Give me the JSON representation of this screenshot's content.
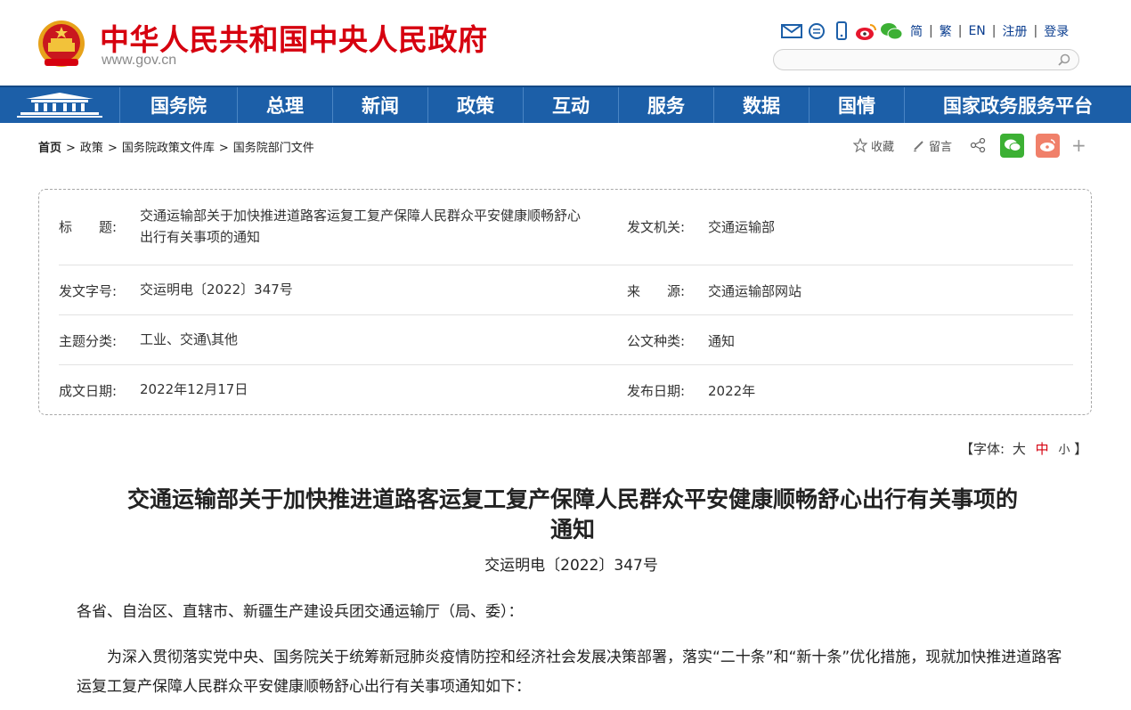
{
  "header": {
    "site_title": "中华人民共和国中央人民政府",
    "site_url": "www.gov.cn",
    "tool_icons": [
      "mail-icon",
      "chat-icon",
      "mobile-icon",
      "weibo-icon",
      "wechat-icon"
    ],
    "languages": [
      "简",
      "繁",
      "EN"
    ],
    "register_label": "注册",
    "login_label": "登录",
    "search_placeholder": ""
  },
  "nav": {
    "items": [
      "国务院",
      "总理",
      "新闻",
      "政策",
      "互动",
      "服务",
      "数据",
      "国情",
      "国家政务服务平台"
    ]
  },
  "breadcrumb": {
    "items": [
      "首页",
      "政策",
      "国务院政策文件库",
      "国务院部门文件"
    ]
  },
  "share": {
    "favorite_label": "收藏",
    "comment_label": "留言"
  },
  "info": {
    "title_label": "标　　题:",
    "title_value_line1": "交通运输部关于加快推进道路客运复工复产保障人民群众平安健康顺畅舒心",
    "title_value_line2": "出行有关事项的通知",
    "issuer_label": "发文机关:",
    "issuer_value": "交通运输部",
    "docno_label": "发文字号:",
    "docno_value": "交运明电〔2022〕347号",
    "source_label": "来　　源:",
    "source_value": "交通运输部网站",
    "topic_label": "主题分类:",
    "topic_value": "工业、交通\\其他",
    "type_label": "公文种类:",
    "type_value": "通知",
    "written_label": "成文日期:",
    "written_value": "2022年12月17日",
    "published_label": "发布日期:",
    "published_value": "2022年"
  },
  "fontsize": {
    "prefix": "【字体:",
    "large": "大",
    "medium": "中",
    "small": "小",
    "suffix": "】"
  },
  "article": {
    "title_line1": "交通运输部关于加快推进道路客运复工复产保障人民群众平安健康顺畅舒心出行有关事项的",
    "title_line2": "通知",
    "doc_number": "交运明电〔2022〕347号",
    "salutation": "各省、自治区、直辖市、新疆生产建设兵团交通运输厅（局、委）：",
    "paragraph1": "为深入贯彻落实党中央、国务院关于统筹新冠肺炎疫情防控和经济社会发展决策部署，落实“二十条”和“新十条”优化措施，现就加快推进道路客运复工复产保障人民群众平安健康顺畅舒心出行有关事项通知如下："
  },
  "colors": {
    "brand_red": "#d6000f",
    "nav_blue": "#1c5fa8",
    "link_blue": "#0a3d8f",
    "wechat_green": "#3cb034",
    "weibo_orange": "#f0806a"
  }
}
